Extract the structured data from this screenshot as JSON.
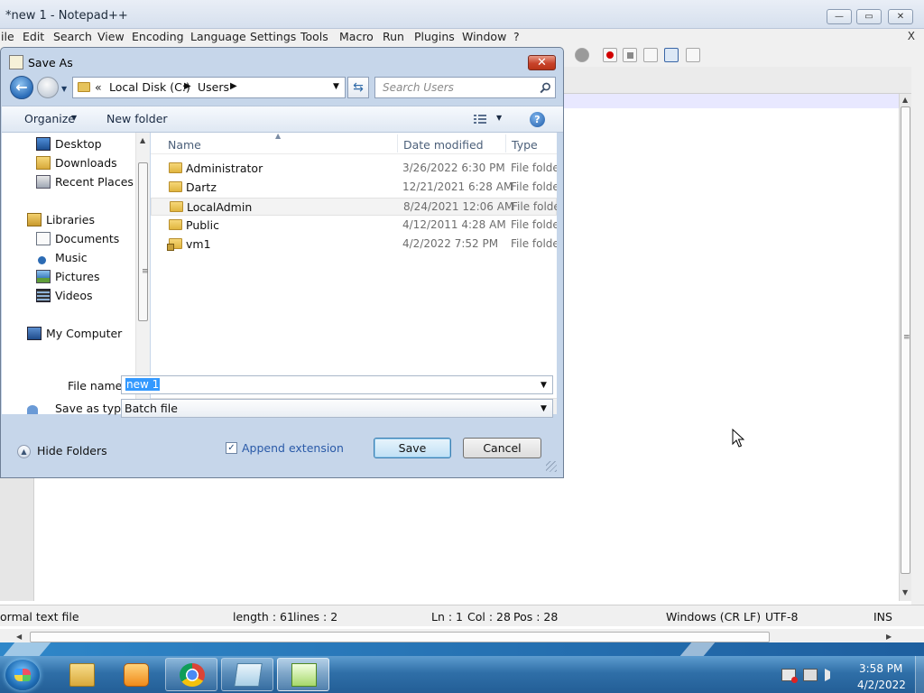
{
  "npp": {
    "title": "*new 1 - Notepad++",
    "controls": {
      "minimize": "—",
      "maximize": "▭",
      "close": "✕"
    },
    "menu": [
      "ile",
      "Edit",
      "Search",
      "View",
      "Encoding",
      "Language",
      "Settings",
      "Tools",
      "Macro",
      "Run",
      "Plugins",
      "Window",
      "?"
    ],
    "menu_close": "X",
    "status": {
      "type": "ormal text file",
      "length": "length : 61",
      "lines": "lines : 2",
      "ln": "Ln : 1",
      "col": "Col : 28",
      "pos": "Pos : 28",
      "eol": "Windows (CR LF)",
      "encoding": "UTF-8",
      "mode": "INS"
    }
  },
  "dialog": {
    "title": "Save As",
    "close": "✕",
    "address": {
      "chevron": "«",
      "crumbs": [
        "Local Disk (C:)",
        "Users"
      ],
      "separator": "▶"
    },
    "search_placeholder": "Search Users",
    "commands": {
      "organize": "Organize",
      "new_folder": "New folder",
      "help": "?"
    },
    "nav": [
      {
        "label": "Desktop",
        "icon": "desktop-icon"
      },
      {
        "label": "Downloads",
        "icon": "downloads-folder-icon"
      },
      {
        "label": "Recent Places",
        "icon": "recent-places-icon"
      },
      {
        "label": "Libraries",
        "icon": "libraries-icon"
      },
      {
        "label": "Documents",
        "icon": "documents-icon"
      },
      {
        "label": "Music",
        "icon": "music-icon"
      },
      {
        "label": "Pictures",
        "icon": "pictures-icon"
      },
      {
        "label": "Videos",
        "icon": "videos-icon"
      },
      {
        "label": "My Computer",
        "icon": "computer-icon"
      }
    ],
    "columns": {
      "name": "Name",
      "date": "Date modified",
      "type": "Type"
    },
    "files": [
      {
        "name": "Administrator",
        "date": "3/26/2022 6:30 PM",
        "type": "File folder"
      },
      {
        "name": "Dartz",
        "date": "12/21/2021 6:28 AM",
        "type": "File folder"
      },
      {
        "name": "LocalAdmin",
        "date": "8/24/2021 12:06 AM",
        "type": "File folder"
      },
      {
        "name": "Public",
        "date": "4/12/2011 4:28 AM",
        "type": "File folder"
      },
      {
        "name": "vm1",
        "date": "4/2/2022 7:52 PM",
        "type": "File folder"
      }
    ],
    "file_name_label": "File name:",
    "file_name_value": "new 1",
    "save_type_label": "Save as type:",
    "save_type_value": "Batch file",
    "hide_folders": "Hide Folders",
    "append_extension": "Append extension",
    "append_checked": true,
    "save": "Save",
    "cancel": "Cancel"
  },
  "taskbar": {
    "apps": [
      {
        "name": "explorer",
        "icon": "folder-icon"
      },
      {
        "name": "media",
        "icon": "media-player-icon"
      },
      {
        "name": "chrome",
        "icon": "chrome-icon"
      },
      {
        "name": "notepad",
        "icon": "notepad-icon"
      },
      {
        "name": "notepad++",
        "icon": "notepadpp-icon"
      }
    ],
    "time": "3:58 PM",
    "date": "4/2/2022"
  }
}
